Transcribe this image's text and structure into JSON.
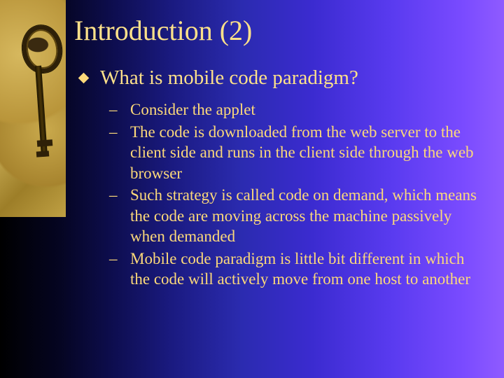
{
  "title": "Introduction (2)",
  "mainBullet": "What is mobile code paradigm?",
  "subItems": [
    "Consider the applet",
    "The code is downloaded from the web server to the client side and runs in the client side through the web browser",
    "Such strategy is called code on demand, which means the code are moving across the machine passively when demanded",
    "Mobile code paradigm is little bit different in which the code will actively move from one host to another"
  ]
}
